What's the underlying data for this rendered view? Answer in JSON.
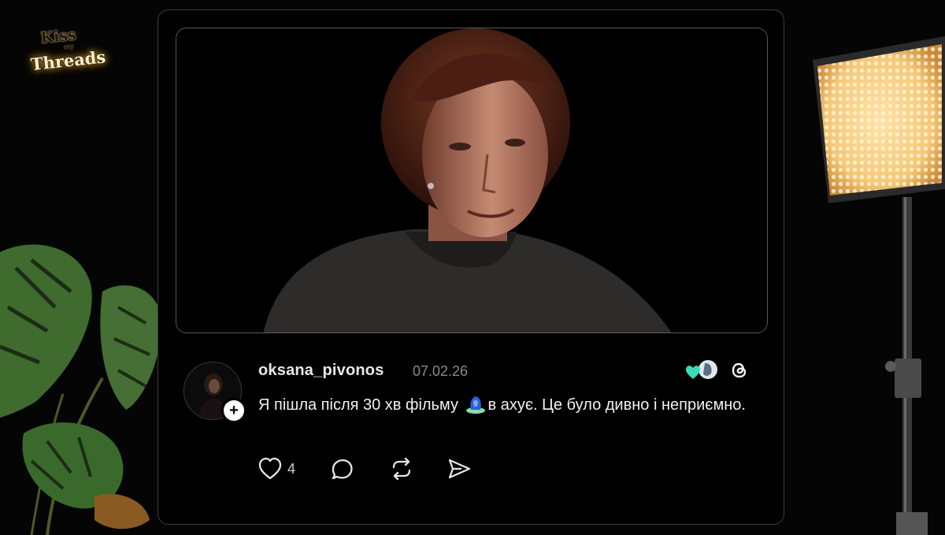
{
  "logo": {
    "kiss": "Kiss",
    "my": "my",
    "threads": "Threads"
  },
  "post": {
    "username": "oksana_pivonos",
    "date": "07.02.26",
    "text_before_emoji": "Я пішла після 30 хв фільму ",
    "text_after_emoji": "в ахує. Це було дивно і неприємно.",
    "likes": "4"
  },
  "colors": {
    "card_border": "#3d3d3d",
    "heart_accent": "#3ddbb5",
    "lamp_glow": "#f6c877",
    "plant_green": "#3f6b2f"
  },
  "icons": [
    "heart-icon",
    "comment-icon",
    "repost-icon",
    "share-icon",
    "threads-logo-icon",
    "plus-icon",
    "emoji-icon"
  ]
}
